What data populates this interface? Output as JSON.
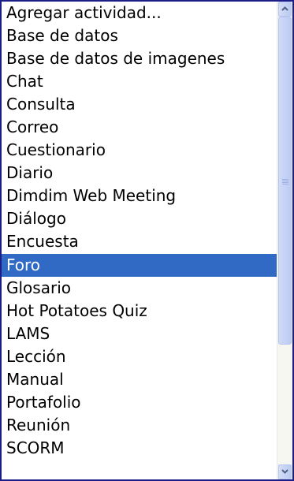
{
  "listbox": {
    "options": [
      "Agregar actividad...",
      "Base de datos",
      "Base de datos de imagenes",
      "Chat",
      "Consulta",
      "Correo",
      "Cuestionario",
      "Diario",
      "Dimdim Web Meeting",
      "Diálogo",
      "Encuesta",
      "Foro",
      "Glosario",
      "Hot Potatoes Quiz",
      "LAMS",
      "Lección",
      "Manual",
      "Portafolio",
      "Reunión",
      "SCORM"
    ],
    "selected": "Foro",
    "colors": {
      "selection_background": "#316ac5",
      "selection_text": "#ffffff",
      "border": "#1d1d8a"
    }
  },
  "scrollbar": {
    "up_icon": "arrow-up-icon",
    "down_icon": "arrow-down-icon",
    "thumb_fraction": 0.69
  }
}
